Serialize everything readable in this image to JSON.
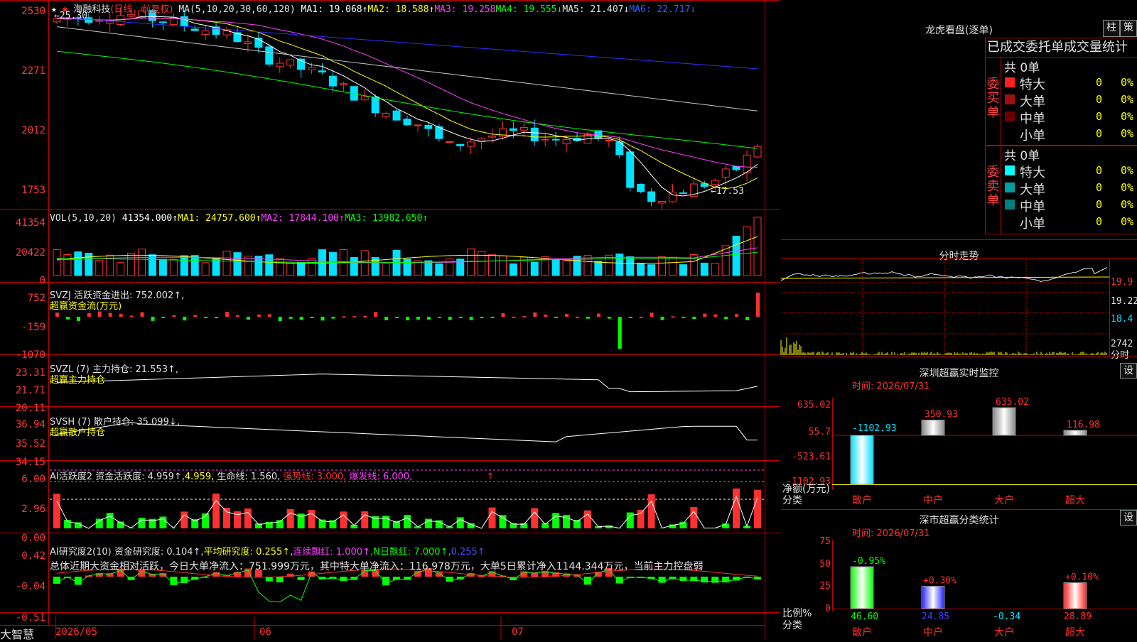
{
  "colors": {
    "up": "#ff3030",
    "down": "#00e0ff",
    "grid": "#c00000",
    "white": "#ffffff",
    "yellow": "#ffff00",
    "magenta": "#ff40ff",
    "green": "#00ff00",
    "blue": "#3030ff",
    "gray": "#aaaaaa"
  },
  "main": {
    "star": "★",
    "stock_name": "海融科技",
    "period": "(日线，前复权)",
    "ma_params": "MA(5,10,20,30,60,120)",
    "ma1": "MA1: 19.068↑",
    "ma2": "MA2: 18.588↑",
    "ma3": "MA3: 19.258",
    "ma4": "MA4: 19.555↓",
    "ma5": "MA5: 21.407↓",
    "ma6": "MA6: 22.717↓",
    "high_marker": "←25.30",
    "low_marker": "←17.53",
    "y_labels": [
      "2530",
      "2271",
      "2012",
      "1753"
    ]
  },
  "vol": {
    "title": "VOL(5,10,20)",
    "value": "41354.000↑",
    "ma1": "MA1: 24757.600↑",
    "ma2": "MA2: 17844.100↑",
    "ma3": "MA3: 13982.650↑",
    "y_labels": [
      "41354",
      "20422",
      "0"
    ]
  },
  "svzj": {
    "title": "SVZJ  活跃资金进出: 752.002↑,",
    "sub": "超赢资金流(万元)",
    "y_labels": [
      "752",
      "-159",
      "-1070"
    ]
  },
  "svzl": {
    "title": "SVZL (7) 主力持仓: 21.553↑,",
    "sub": "超赢主力持仓",
    "y_labels": [
      "23.31",
      "21.71",
      "20.11"
    ]
  },
  "svsh": {
    "title": "SVSH (7) 散户持仓: 35.099↓,",
    "sub": "超赢散户持仓",
    "y_labels": [
      "36.94",
      "35.52",
      "34.15"
    ]
  },
  "ai1": {
    "title": "AI活跃度2 资金活跃度: 4.959↑,",
    "t2": "4.959,",
    "t3": "生命线: 1.560,",
    "t4": "强势线: 3.000,",
    "t5": "爆发线: 6.000,",
    "t6": "↑",
    "y_labels": [
      "6.00",
      "2.96",
      "0.00"
    ]
  },
  "ai2": {
    "title": "AI研究度2(10) 资金研究度: 0.104↑,",
    "t2": "平均研究度: 0.255↑,",
    "t3": "连续飘红: 1.000↑,",
    "t4": "N日飘红: 7.000↑,",
    "t5": "0.255↑",
    "summary": "总体近期大资金相对活跃，今日大单净流入：751.999万元，其中特大单净流入：116.978万元，大单5日累计净入1144.344万元，当前主力控盘弱",
    "y_labels": [
      "0.42",
      "-0.04",
      "-0.51"
    ]
  },
  "xaxis": {
    "labels": [
      "2026/05",
      "06",
      "07"
    ]
  },
  "brand": "大智慧",
  "right": {
    "lhb_title": "龙虎看盘(逐单)",
    "btn_zhu": "柱",
    "btn_ce": "策",
    "tabs": "已成交委托单成交量统计",
    "buy_label": "委买单",
    "sell_label": "委卖单",
    "buy_total": "共 0单",
    "sell_total": "共 0单",
    "buy_rows": [
      {
        "name": "特大",
        "val": "0",
        "pct": "0%",
        "color": "#ff2020"
      },
      {
        "name": "大单",
        "val": "0",
        "pct": "0%",
        "color": "#a01010"
      },
      {
        "name": "中单",
        "val": "0",
        "pct": "0%",
        "color": "#700000"
      },
      {
        "name": "小单",
        "val": "0",
        "pct": "0%",
        "color": "#000000"
      }
    ],
    "sell_rows": [
      {
        "name": "特大",
        "val": "0",
        "pct": "0%",
        "color": "#00ffff"
      },
      {
        "name": "大单",
        "val": "0",
        "pct": "0%",
        "color": "#00a0a0"
      },
      {
        "name": "中单",
        "val": "0",
        "pct": "0%",
        "color": "#008080"
      },
      {
        "name": "小单",
        "val": "0",
        "pct": "0%",
        "color": "#000000"
      }
    ],
    "fs_title": "分时走势",
    "fs_labels": [
      "19.9",
      "19.22",
      "18.4",
      "2742",
      "分时"
    ],
    "sz_title": "深圳超赢实时监控",
    "sz_time": "时间: 2026/07/31",
    "sz_btn": "设",
    "sz_y": [
      "635.02",
      "55.7",
      "-523.61",
      "-1102.93"
    ],
    "sz_bars": [
      {
        "label": "-1102.93",
        "value": -1102.93,
        "cat": "散户"
      },
      {
        "label": "350.93",
        "value": 350.93,
        "cat": "中户"
      },
      {
        "label": "635.02",
        "value": 635.02,
        "cat": "大户"
      },
      {
        "label": "116.98",
        "value": 116.98,
        "cat": "超大"
      }
    ],
    "sz_left1": "净额(万元)",
    "sz_left2": "分类",
    "fl_title": "深市超赢分类统计",
    "fl_time": "时间: 2026/07/31",
    "fl_btn": "设",
    "fl_y": [
      "75",
      "50",
      "25",
      "0"
    ],
    "fl_bars": [
      {
        "top": "-0.95%",
        "bottom": "46.60",
        "value": 46.6,
        "cat": "散户"
      },
      {
        "top": "+0.30%",
        "bottom": "24.85",
        "value": 24.85,
        "cat": "中户"
      },
      {
        "top": "",
        "bottom": "-0.34",
        "value": 0,
        "cat": "大户"
      },
      {
        "top": "+0.10%",
        "bottom": "28.89",
        "value": 28.89,
        "cat": "超大"
      }
    ],
    "fl_left1": "比例%",
    "fl_left2": "分类"
  }
}
